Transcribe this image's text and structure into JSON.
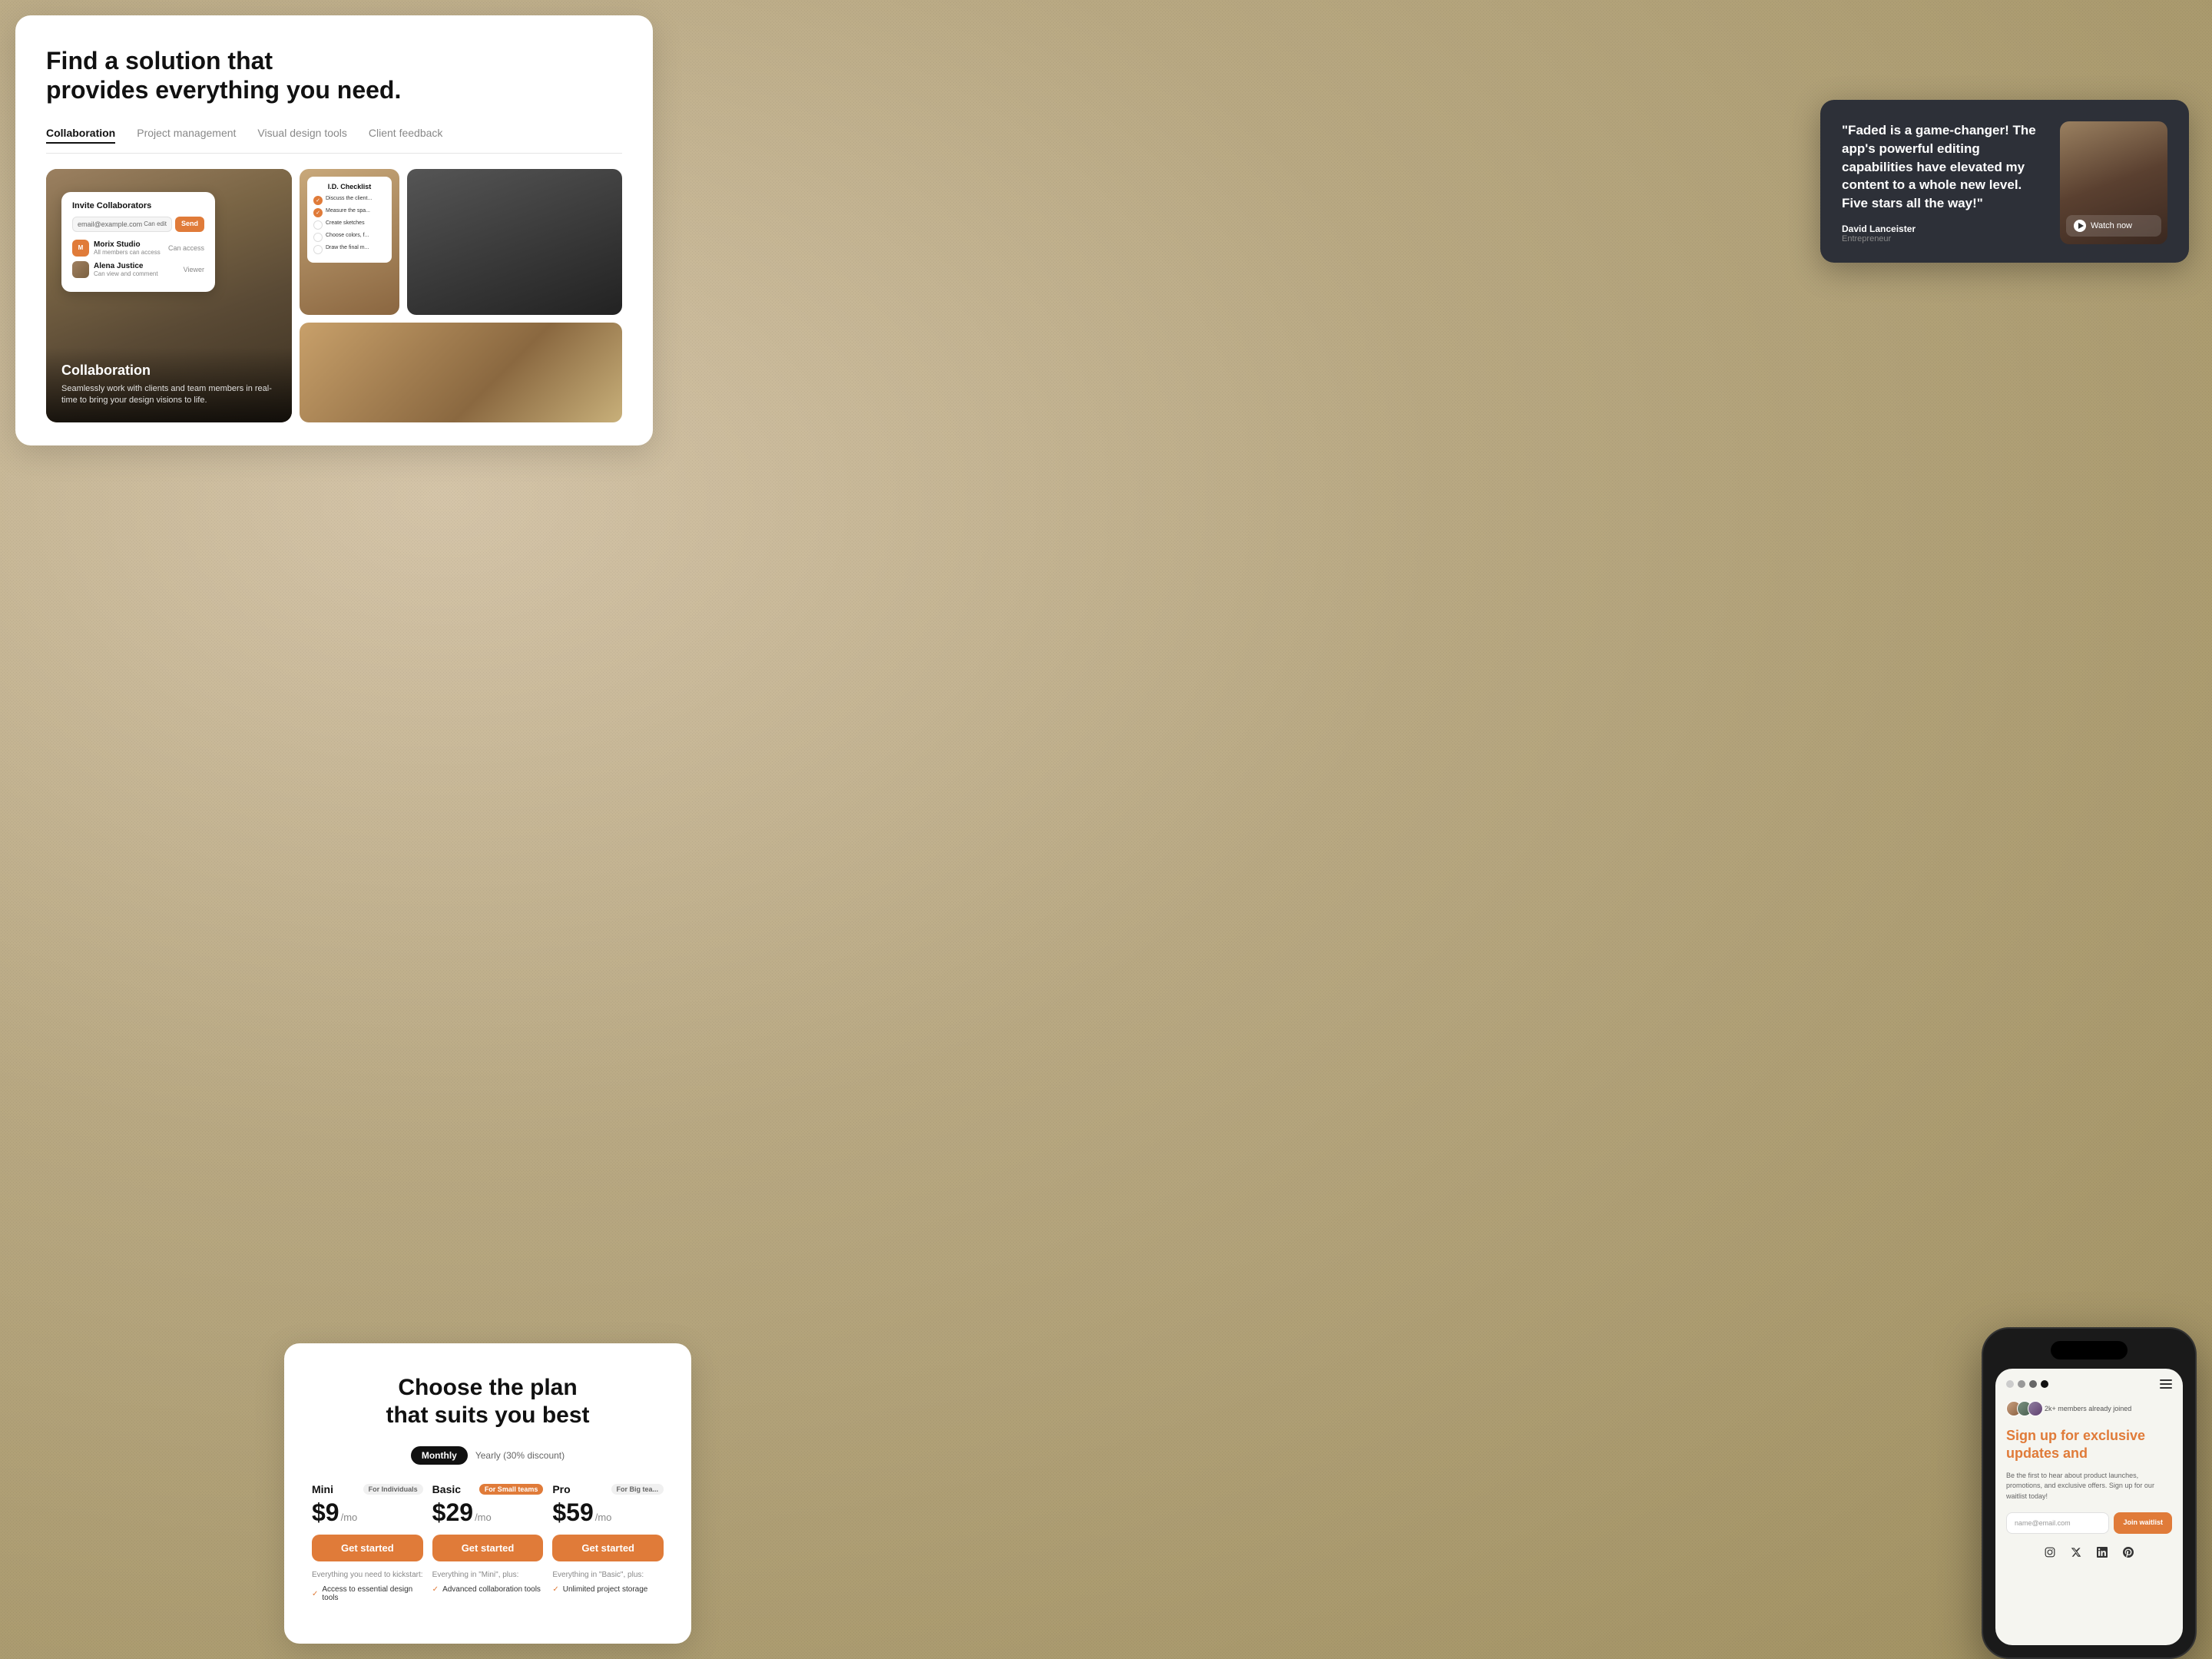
{
  "top_card": {
    "title_line1": "Find a solution that",
    "title_line2": "provides everything you need.",
    "tabs": [
      {
        "label": "Collaboration",
        "active": true
      },
      {
        "label": "Project management",
        "active": false
      },
      {
        "label": "Visual design tools",
        "active": false
      },
      {
        "label": "Client feedback",
        "active": false
      }
    ],
    "collaboration": {
      "label": "Collaboration",
      "description": "Seamlessly work with clients and team members in real-time to bring your design visions to life."
    },
    "invite_ui": {
      "title": "Invite Collaborators",
      "email_placeholder": "email@example.com",
      "permission": "Can edit",
      "send_button": "Send",
      "users": [
        {
          "name": "Morix Studio",
          "sub": "All members can access",
          "access": "Can access"
        },
        {
          "name": "Alena Justice",
          "sub": "Can view and comment",
          "access": "Viewer"
        }
      ]
    },
    "checklist": {
      "title": "I.D. Checklist",
      "items": [
        {
          "text": "Discuss the client...",
          "checked": true
        },
        {
          "text": "Measure the spa...",
          "checked": true
        },
        {
          "text": "Create sketches",
          "checked": false
        },
        {
          "text": "Choose colors, f...",
          "checked": false
        },
        {
          "text": "Draw the final m...",
          "checked": false
        }
      ]
    }
  },
  "testimonial": {
    "quote": "\"Faded is a game-changer! The app's powerful editing capabilities have elevated my content to a whole new level. Five stars all the way!\"",
    "author": "David Lanceister",
    "role": "Entrepreneur",
    "watch_label": "Watch now"
  },
  "pricing": {
    "title_line1": "Choose the plan",
    "title_line2": "that suits you best",
    "billing_monthly": "Monthly",
    "billing_yearly": "Yearly (30% discount)",
    "plans": [
      {
        "name": "Mini",
        "badge": "For Individuals",
        "badge_type": "individuals",
        "price": "$9",
        "price_unit": "/mo",
        "cta": "Get started",
        "divider_text": "Everything you need to kickstart:",
        "features": [
          "Access to essential design tools"
        ]
      },
      {
        "name": "Basic",
        "badge": "For Small teams",
        "badge_type": "small-teams",
        "price": "$29",
        "price_unit": "/mo",
        "cta": "Get started",
        "divider_text": "Everything in \"Mini\", plus:",
        "features": [
          "Advanced collaboration tools"
        ]
      },
      {
        "name": "Pro",
        "badge": "For Big tea...",
        "badge_type": "big-teams",
        "price": "$59",
        "price_unit": "/mo",
        "cta": "Get started",
        "divider_text": "Everything in \"Basic\", plus:",
        "features": [
          "Unlimited project storage"
        ]
      }
    ]
  },
  "mobile": {
    "members_text": "2k+ members already joined",
    "headline_line1": "Sign up for exclusive",
    "headline_line2": "updates an",
    "headline_highlight": "d",
    "body_text": "Be the first to hear about product launches, promotions, and exclusive offers. Sign up for our waitlist today!",
    "email_placeholder": "name@email.com",
    "join_button": "Join waitlist",
    "social_icons": [
      "instagram",
      "twitter",
      "linkedin",
      "pinterest"
    ]
  }
}
